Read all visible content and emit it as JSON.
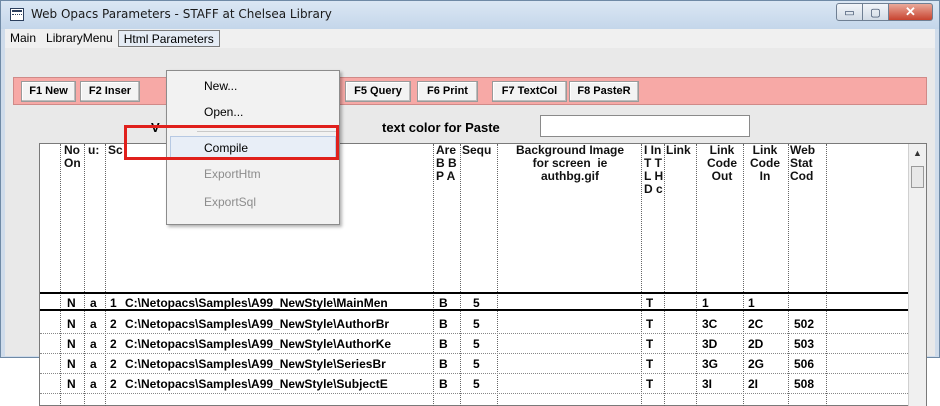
{
  "window": {
    "title": "Web Opacs Parameters  - STAFF at Chelsea Library",
    "min_glyph": "▭",
    "max_glyph": "▢",
    "close_glyph": "✕"
  },
  "menubar": {
    "items": [
      "Main",
      "LibraryMenu",
      "Html Parameters"
    ]
  },
  "toolbar": {
    "buttons": [
      "F1 New",
      "F2 Inser",
      "F5 Query",
      "F6 Print",
      "F7 TextCol",
      "F8 PasteR"
    ]
  },
  "params": {
    "label_v": "V",
    "text_color_label": "text color for Paste",
    "text_color_value": ""
  },
  "grid": {
    "headers": {
      "no_on": "No\nOn",
      "u": "u:",
      "sc": "Sc",
      "area": "Are\nB B\nP A",
      "sequ": "Sequ",
      "bgimage": "Background Image\nfor screen  ie\nauthbg.gif",
      "iin": "I In\nT T\nL H\nD c",
      "link": "Link",
      "link_out": "Link\nCode\nOut",
      "link_in": "Link\nCode\nIn",
      "web_stat": "Web\nStat\nCod"
    },
    "rows": [
      {
        "n": "N",
        "a": "a",
        "num": "1",
        "path": "C:\\Netopacs\\Samples\\A99_NewStyle\\MainMen",
        "area": "B",
        "seq": "5",
        "bg": "",
        "t": "T",
        "link": "",
        "out": "1",
        "in": "1",
        "web": ""
      },
      {
        "n": "N",
        "a": "a",
        "num": "2",
        "path": "C:\\Netopacs\\Samples\\A99_NewStyle\\AuthorBr",
        "area": "B",
        "seq": "5",
        "bg": "",
        "t": "T",
        "link": "",
        "out": "3C",
        "in": "2C",
        "web": "502"
      },
      {
        "n": "N",
        "a": "a",
        "num": "2",
        "path": "C:\\Netopacs\\Samples\\A99_NewStyle\\AuthorKe",
        "area": "B",
        "seq": "5",
        "bg": "",
        "t": "T",
        "link": "",
        "out": "3D",
        "in": "2D",
        "web": "503"
      },
      {
        "n": "N",
        "a": "a",
        "num": "2",
        "path": "C:\\Netopacs\\Samples\\A99_NewStyle\\SeriesBr",
        "area": "B",
        "seq": "5",
        "bg": "",
        "t": "T",
        "link": "",
        "out": "3G",
        "in": "2G",
        "web": "506"
      },
      {
        "n": "N",
        "a": "a",
        "num": "2",
        "path": "C:\\Netopacs\\Samples\\A99_NewStyle\\SubjectE",
        "area": "B",
        "seq": "5",
        "bg": "",
        "t": "T",
        "link": "",
        "out": "3I",
        "in": "2I",
        "web": "508"
      }
    ]
  },
  "dropdown": {
    "items": [
      {
        "label": "New...",
        "enabled": true
      },
      {
        "label": "Open...",
        "enabled": true
      },
      {
        "label": "Compile",
        "enabled": true
      },
      {
        "label": "ExportHtm",
        "enabled": false
      },
      {
        "label": "ExportSql",
        "enabled": false
      }
    ]
  },
  "colors": {
    "toolbar_bg": "#f7a9a6",
    "highlight": "#e0201c"
  }
}
